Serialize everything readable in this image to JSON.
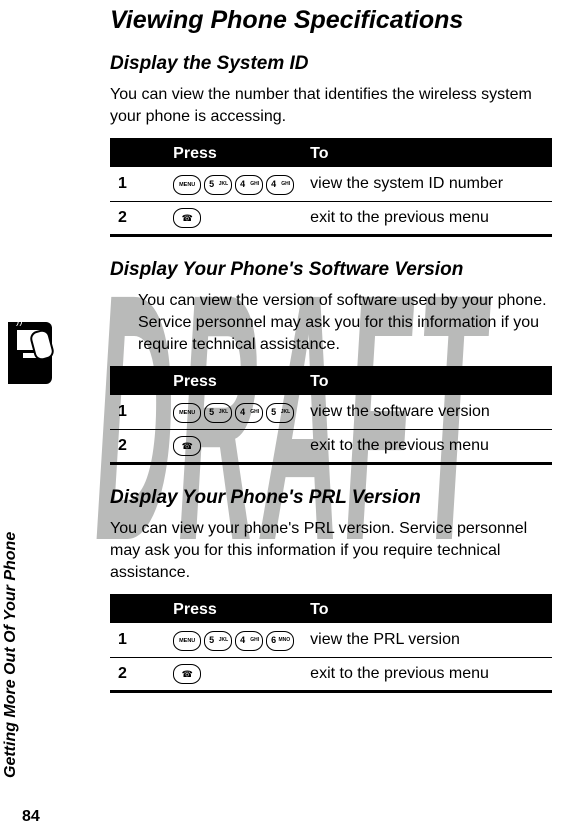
{
  "watermark": "DRAFT",
  "sidebar_label": "Getting More Out Of Your Phone",
  "page_number": "84",
  "title": "Viewing Phone Specifications",
  "sections": [
    {
      "heading": "Display the System ID",
      "body": "You can view the number that identifies the wireless system your phone is accessing.",
      "indented": false,
      "table": {
        "head": {
          "c1": "",
          "c2": "Press",
          "c3": "To"
        },
        "rows": [
          {
            "n": "1",
            "keys": "menu 5 4 4",
            "to": "view the system ID number"
          },
          {
            "n": "2",
            "keys": "end",
            "to": "exit to the previous menu"
          }
        ]
      }
    },
    {
      "heading": "Display Your Phone's Software Version",
      "body": "You can view the version of software used by your phone. Service personnel may ask you for this information if you require technical assistance.",
      "indented": true,
      "table": {
        "head": {
          "c1": "",
          "c2": "Press",
          "c3": "To"
        },
        "rows": [
          {
            "n": "1",
            "keys": "menu 5 4 5",
            "to": "view the software version"
          },
          {
            "n": "2",
            "keys": "end",
            "to": "exit to the previous menu"
          }
        ]
      }
    },
    {
      "heading": "Display Your Phone's PRL Version",
      "body": "You can view your phone's PRL version. Service personnel may ask you for this information if you require technical assistance.",
      "indented": false,
      "table": {
        "head": {
          "c1": "",
          "c2": "Press",
          "c3": "To"
        },
        "rows": [
          {
            "n": "1",
            "keys": "menu 5 4 6",
            "to": "view the PRL version"
          },
          {
            "n": "2",
            "keys": "end",
            "to": "exit to the previous menu"
          }
        ]
      }
    }
  ]
}
